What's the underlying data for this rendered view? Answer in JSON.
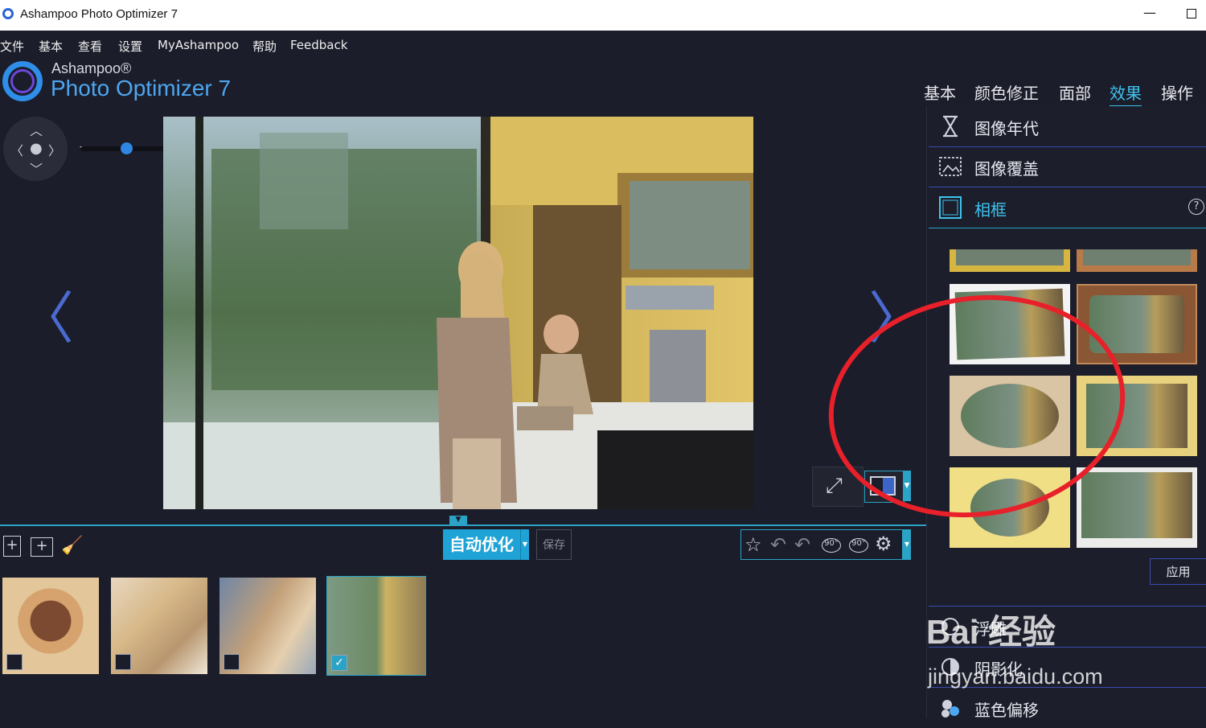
{
  "window": {
    "title": "Ashampoo Photo Optimizer 7"
  },
  "menu": [
    "文件",
    "基本",
    "查看",
    "设置",
    "MyAshampoo",
    "帮助",
    "Feedback"
  ],
  "brand": {
    "small": "Ashampoo®",
    "big": "Photo Optimizer 7"
  },
  "top_tabs": [
    {
      "label": "基本",
      "active": false
    },
    {
      "label": "颜色修正",
      "active": false
    },
    {
      "label": "面部",
      "active": false
    },
    {
      "label": "效果",
      "active": true
    },
    {
      "label": "操作",
      "active": false
    }
  ],
  "effects_panel": {
    "rows": [
      {
        "label": "图像年代",
        "icon": "hourglass-icon"
      },
      {
        "label": "图像覆盖",
        "icon": "overlay-icon"
      },
      {
        "label": "相框",
        "icon": "frame-icon",
        "active": true
      }
    ],
    "help_label": "?",
    "apply_label": "应用",
    "bottom_rows": [
      {
        "label": "浮雕",
        "icon": "emboss-icon"
      },
      {
        "label": "阴影化",
        "icon": "shadow-icon"
      },
      {
        "label": "蓝色偏移",
        "icon": "blue-shift-icon"
      }
    ]
  },
  "toolbar": {
    "auto_optimize_label": "自动优化",
    "save_label": "保存",
    "rotate_left_label": "90°",
    "rotate_right_label": "90°"
  },
  "zoom": {
    "minus": "−",
    "plus": "+",
    "level": 0.36
  },
  "watermark": {
    "brand": "Bai 经验",
    "url": "jingyan.baidu.com"
  },
  "colors": {
    "accent": "#3ec3ee",
    "background": "#1b1d2a",
    "annotation": "#e8202a"
  }
}
